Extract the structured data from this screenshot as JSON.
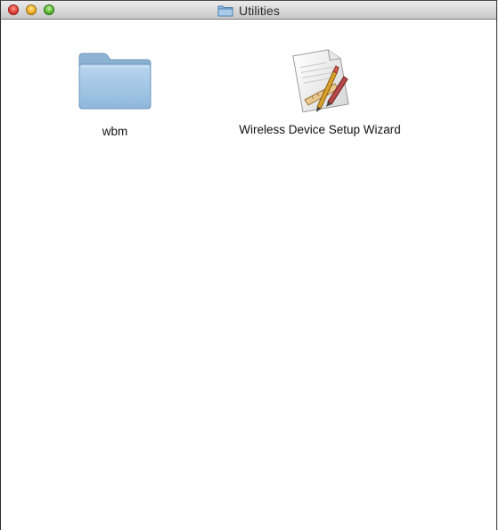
{
  "window": {
    "title": "Utilities",
    "controls": {
      "close": "close-button",
      "minimize": "minimize-button",
      "zoom": "zoom-button"
    }
  },
  "items": [
    {
      "label": "wbm",
      "icon": "folder-icon"
    },
    {
      "label": "Wireless Device Setup Wizard",
      "icon": "app-icon"
    }
  ],
  "colors": {
    "close": "#e0413a",
    "minimize": "#f0b22f",
    "zoom": "#5fbb3a",
    "folder": "#9cc4e4"
  }
}
